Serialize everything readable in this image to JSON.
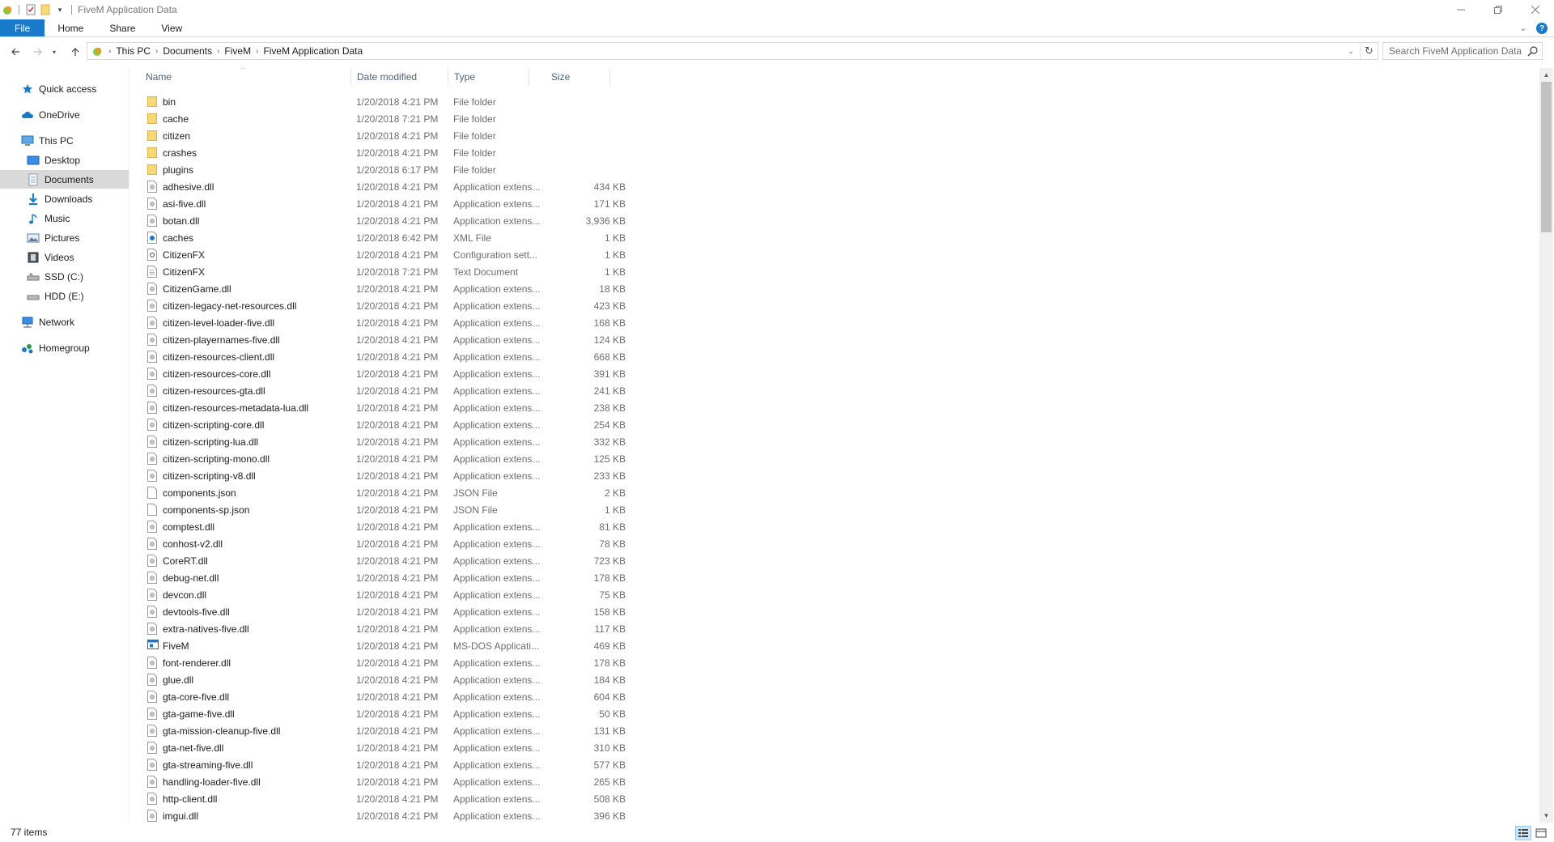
{
  "window": {
    "title": "FiveM Application Data"
  },
  "ribbon": {
    "tabs": [
      "File",
      "Home",
      "Share",
      "View"
    ]
  },
  "address": {
    "crumbs": [
      "This PC",
      "Documents",
      "FiveM",
      "FiveM Application Data"
    ]
  },
  "search": {
    "placeholder": "Search FiveM Application Data"
  },
  "sidebar": {
    "items": [
      {
        "label": "Quick access",
        "icon": "star-icon"
      },
      {
        "label": "OneDrive",
        "icon": "cloud-icon"
      },
      {
        "label": "This PC",
        "icon": "computer-icon"
      },
      {
        "label": "Desktop",
        "icon": "desktop-icon"
      },
      {
        "label": "Documents",
        "icon": "documents-icon",
        "selected": true
      },
      {
        "label": "Downloads",
        "icon": "download-icon"
      },
      {
        "label": "Music",
        "icon": "music-icon"
      },
      {
        "label": "Pictures",
        "icon": "pictures-icon"
      },
      {
        "label": "Videos",
        "icon": "videos-icon"
      },
      {
        "label": "SSD (C:)",
        "icon": "drive-icon"
      },
      {
        "label": "HDD (E:)",
        "icon": "drive-icon"
      },
      {
        "label": "Network",
        "icon": "network-icon"
      },
      {
        "label": "Homegroup",
        "icon": "homegroup-icon"
      }
    ]
  },
  "columns": {
    "name": "Name",
    "date": "Date modified",
    "type": "Type",
    "size": "Size"
  },
  "files": [
    {
      "name": "bin",
      "date": "1/20/2018 4:21 PM",
      "type": "File folder",
      "size": "",
      "kind": "folder"
    },
    {
      "name": "cache",
      "date": "1/20/2018 7:21 PM",
      "type": "File folder",
      "size": "",
      "kind": "folder"
    },
    {
      "name": "citizen",
      "date": "1/20/2018 4:21 PM",
      "type": "File folder",
      "size": "",
      "kind": "folder"
    },
    {
      "name": "crashes",
      "date": "1/20/2018 4:21 PM",
      "type": "File folder",
      "size": "",
      "kind": "folder"
    },
    {
      "name": "plugins",
      "date": "1/20/2018 6:17 PM",
      "type": "File folder",
      "size": "",
      "kind": "folder"
    },
    {
      "name": "adhesive.dll",
      "date": "1/20/2018 4:21 PM",
      "type": "Application extens...",
      "size": "434 KB",
      "kind": "dll"
    },
    {
      "name": "asi-five.dll",
      "date": "1/20/2018 4:21 PM",
      "type": "Application extens...",
      "size": "171 KB",
      "kind": "dll"
    },
    {
      "name": "botan.dll",
      "date": "1/20/2018 4:21 PM",
      "type": "Application extens...",
      "size": "3,936 KB",
      "kind": "dll"
    },
    {
      "name": "caches",
      "date": "1/20/2018 6:42 PM",
      "type": "XML File",
      "size": "1 KB",
      "kind": "xml"
    },
    {
      "name": "CitizenFX",
      "date": "1/20/2018 4:21 PM",
      "type": "Configuration sett...",
      "size": "1 KB",
      "kind": "config"
    },
    {
      "name": "CitizenFX",
      "date": "1/20/2018 7:21 PM",
      "type": "Text Document",
      "size": "1 KB",
      "kind": "text"
    },
    {
      "name": "CitizenGame.dll",
      "date": "1/20/2018 4:21 PM",
      "type": "Application extens...",
      "size": "18 KB",
      "kind": "dll"
    },
    {
      "name": "citizen-legacy-net-resources.dll",
      "date": "1/20/2018 4:21 PM",
      "type": "Application extens...",
      "size": "423 KB",
      "kind": "dll"
    },
    {
      "name": "citizen-level-loader-five.dll",
      "date": "1/20/2018 4:21 PM",
      "type": "Application extens...",
      "size": "168 KB",
      "kind": "dll"
    },
    {
      "name": "citizen-playernames-five.dll",
      "date": "1/20/2018 4:21 PM",
      "type": "Application extens...",
      "size": "124 KB",
      "kind": "dll"
    },
    {
      "name": "citizen-resources-client.dll",
      "date": "1/20/2018 4:21 PM",
      "type": "Application extens...",
      "size": "668 KB",
      "kind": "dll"
    },
    {
      "name": "citizen-resources-core.dll",
      "date": "1/20/2018 4:21 PM",
      "type": "Application extens...",
      "size": "391 KB",
      "kind": "dll"
    },
    {
      "name": "citizen-resources-gta.dll",
      "date": "1/20/2018 4:21 PM",
      "type": "Application extens...",
      "size": "241 KB",
      "kind": "dll"
    },
    {
      "name": "citizen-resources-metadata-lua.dll",
      "date": "1/20/2018 4:21 PM",
      "type": "Application extens...",
      "size": "238 KB",
      "kind": "dll"
    },
    {
      "name": "citizen-scripting-core.dll",
      "date": "1/20/2018 4:21 PM",
      "type": "Application extens...",
      "size": "254 KB",
      "kind": "dll"
    },
    {
      "name": "citizen-scripting-lua.dll",
      "date": "1/20/2018 4:21 PM",
      "type": "Application extens...",
      "size": "332 KB",
      "kind": "dll"
    },
    {
      "name": "citizen-scripting-mono.dll",
      "date": "1/20/2018 4:21 PM",
      "type": "Application extens...",
      "size": "125 KB",
      "kind": "dll"
    },
    {
      "name": "citizen-scripting-v8.dll",
      "date": "1/20/2018 4:21 PM",
      "type": "Application extens...",
      "size": "233 KB",
      "kind": "dll"
    },
    {
      "name": "components.json",
      "date": "1/20/2018 4:21 PM",
      "type": "JSON File",
      "size": "2 KB",
      "kind": "json"
    },
    {
      "name": "components-sp.json",
      "date": "1/20/2018 4:21 PM",
      "type": "JSON File",
      "size": "1 KB",
      "kind": "json"
    },
    {
      "name": "comptest.dll",
      "date": "1/20/2018 4:21 PM",
      "type": "Application extens...",
      "size": "81 KB",
      "kind": "dll"
    },
    {
      "name": "conhost-v2.dll",
      "date": "1/20/2018 4:21 PM",
      "type": "Application extens...",
      "size": "78 KB",
      "kind": "dll"
    },
    {
      "name": "CoreRT.dll",
      "date": "1/20/2018 4:21 PM",
      "type": "Application extens...",
      "size": "723 KB",
      "kind": "dll"
    },
    {
      "name": "debug-net.dll",
      "date": "1/20/2018 4:21 PM",
      "type": "Application extens...",
      "size": "178 KB",
      "kind": "dll"
    },
    {
      "name": "devcon.dll",
      "date": "1/20/2018 4:21 PM",
      "type": "Application extens...",
      "size": "75 KB",
      "kind": "dll"
    },
    {
      "name": "devtools-five.dll",
      "date": "1/20/2018 4:21 PM",
      "type": "Application extens...",
      "size": "158 KB",
      "kind": "dll"
    },
    {
      "name": "extra-natives-five.dll",
      "date": "1/20/2018 4:21 PM",
      "type": "Application extens...",
      "size": "117 KB",
      "kind": "dll"
    },
    {
      "name": "FiveM",
      "date": "1/20/2018 4:21 PM",
      "type": "MS-DOS Applicati...",
      "size": "469 KB",
      "kind": "exe"
    },
    {
      "name": "font-renderer.dll",
      "date": "1/20/2018 4:21 PM",
      "type": "Application extens...",
      "size": "178 KB",
      "kind": "dll"
    },
    {
      "name": "glue.dll",
      "date": "1/20/2018 4:21 PM",
      "type": "Application extens...",
      "size": "184 KB",
      "kind": "dll"
    },
    {
      "name": "gta-core-five.dll",
      "date": "1/20/2018 4:21 PM",
      "type": "Application extens...",
      "size": "604 KB",
      "kind": "dll"
    },
    {
      "name": "gta-game-five.dll",
      "date": "1/20/2018 4:21 PM",
      "type": "Application extens...",
      "size": "50 KB",
      "kind": "dll"
    },
    {
      "name": "gta-mission-cleanup-five.dll",
      "date": "1/20/2018 4:21 PM",
      "type": "Application extens...",
      "size": "131 KB",
      "kind": "dll"
    },
    {
      "name": "gta-net-five.dll",
      "date": "1/20/2018 4:21 PM",
      "type": "Application extens...",
      "size": "310 KB",
      "kind": "dll"
    },
    {
      "name": "gta-streaming-five.dll",
      "date": "1/20/2018 4:21 PM",
      "type": "Application extens...",
      "size": "577 KB",
      "kind": "dll"
    },
    {
      "name": "handling-loader-five.dll",
      "date": "1/20/2018 4:21 PM",
      "type": "Application extens...",
      "size": "265 KB",
      "kind": "dll"
    },
    {
      "name": "http-client.dll",
      "date": "1/20/2018 4:21 PM",
      "type": "Application extens...",
      "size": "508 KB",
      "kind": "dll"
    },
    {
      "name": "imgui.dll",
      "date": "1/20/2018 4:21 PM",
      "type": "Application extens...",
      "size": "396 KB",
      "kind": "dll"
    }
  ],
  "status": {
    "count": "77 items"
  },
  "colors": {
    "accent": "#1979ca",
    "folder": "#f8d775",
    "selected_nav": "#d9d9d9",
    "header_text": "#4c607a"
  }
}
